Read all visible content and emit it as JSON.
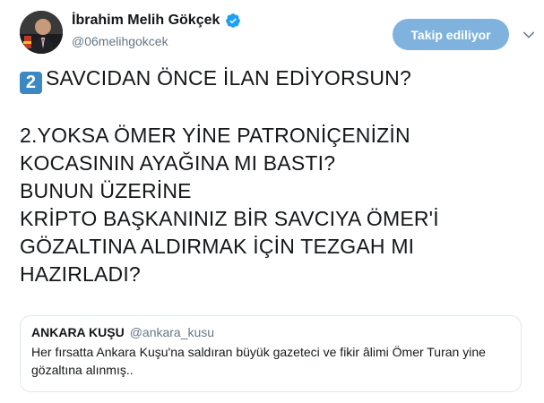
{
  "author": {
    "display_name": "İbrahim Melih Gökçek",
    "handle": "@06melihgokcek",
    "verified": true
  },
  "actions": {
    "follow_label": "Takip ediliyor"
  },
  "tweet": {
    "keycap": "2",
    "lines": [
      "SAVCIDAN ÖNCE İLAN EDİYORSUN?",
      "",
      "2.YOKSA ÖMER YİNE PATRONİÇENİZİN",
      "KOCASININ AYAĞINA MI BASTI?",
      "BUNUN ÜZERİNE",
      "KRİPTO BAŞKANINIZ BİR SAVCIYA ÖMER'İ",
      "GÖZALTINA ALDIRMAK İÇİN TEZGAH MI",
      "HAZIRLADI?"
    ]
  },
  "quote": {
    "name": "ANKARA KUŞU",
    "handle": "@ankara_kusu",
    "text": "Her fırsatta Ankara Kuşu'na saldıran büyük gazeteci ve fikir âlimi Ömer Turan yine gözaltına alınmış.."
  },
  "colors": {
    "follow_button": "#7fb3dd",
    "verified": "#1da1f2",
    "keycap": "#3b88c3",
    "muted_text": "#657786"
  },
  "icons": {
    "verified": "verified-badge-icon",
    "caret": "chevron-down-icon"
  }
}
